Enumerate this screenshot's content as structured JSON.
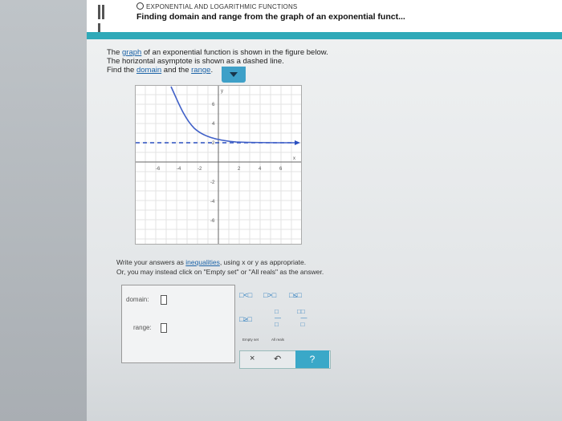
{
  "header": {
    "topic": "EXPONENTIAL AND LOGARITHMIC FUNCTIONS",
    "title": "Finding domain and range from the graph of an exponential funct..."
  },
  "prompt": {
    "line1_pre": "The ",
    "line1_link": "graph",
    "line1_post": " of an exponential function is shown in the figure below.",
    "line2": "The horizontal asymptote is shown as a dashed line.",
    "line3_pre": "Find the ",
    "line3_link1": "domain",
    "line3_mid": " and the ",
    "line3_link2": "range",
    "line3_post": "."
  },
  "instructions": {
    "line1_pre": "Write your answers as ",
    "line1_link": "inequalities",
    "line1_post": ", using x or y as appropriate.",
    "line2": "Or, you may instead click on \"Empty set\" or \"All reals\" as the answer."
  },
  "answers": {
    "domain_label": "domain:",
    "range_label": "range:"
  },
  "palette": {
    "lt": "<",
    "gt": ">",
    "le": "≤",
    "ge": "≥",
    "empty_set": "Empty set",
    "all_reals": "All reals"
  },
  "actions": {
    "clear": "×",
    "undo": "↶",
    "help": "?"
  },
  "graph": {
    "x_ticks": [
      "-6",
      "-4",
      "-2",
      "2",
      "4",
      "6"
    ],
    "y_ticks": [
      "6",
      "4",
      "2",
      "-2",
      "-4",
      "-6"
    ],
    "x_label": "x",
    "y_label": "y",
    "asymptote_y": 2
  }
}
